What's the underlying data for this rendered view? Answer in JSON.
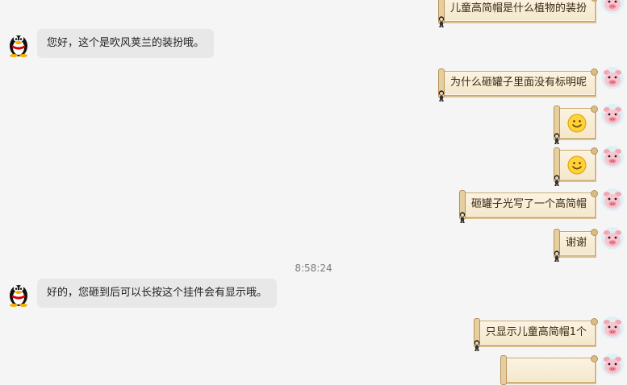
{
  "messages": {
    "user_1": "儿童高简帽是什么植物的装扮",
    "agent_1": "您好，这个是吹风荚兰的装扮哦。",
    "user_2": "为什么砸罐子里面没有标明呢",
    "user_3_emoji": "smile-emoji",
    "user_4_emoji": "smile-emoji",
    "user_5": "砸罐子光写了一个高简帽",
    "user_6": "谢谢",
    "timestamp": "8:58:24",
    "agent_2": "好的，您砸到后可以长按这个挂件会有显示哦。",
    "user_7": "只显示儿童高简帽1个",
    "user_8": ""
  },
  "icons": {
    "agent_avatar": "qq-penguin-icon",
    "user_avatar": "pig-avatar-icon",
    "bubble_decoration": "scroll-figure-icon"
  },
  "colors": {
    "background": "#f5f5f5",
    "agent_bubble": "#e8e8e8",
    "user_bubble": "#f4e7cb",
    "user_bubble_border": "#c9a66b"
  }
}
